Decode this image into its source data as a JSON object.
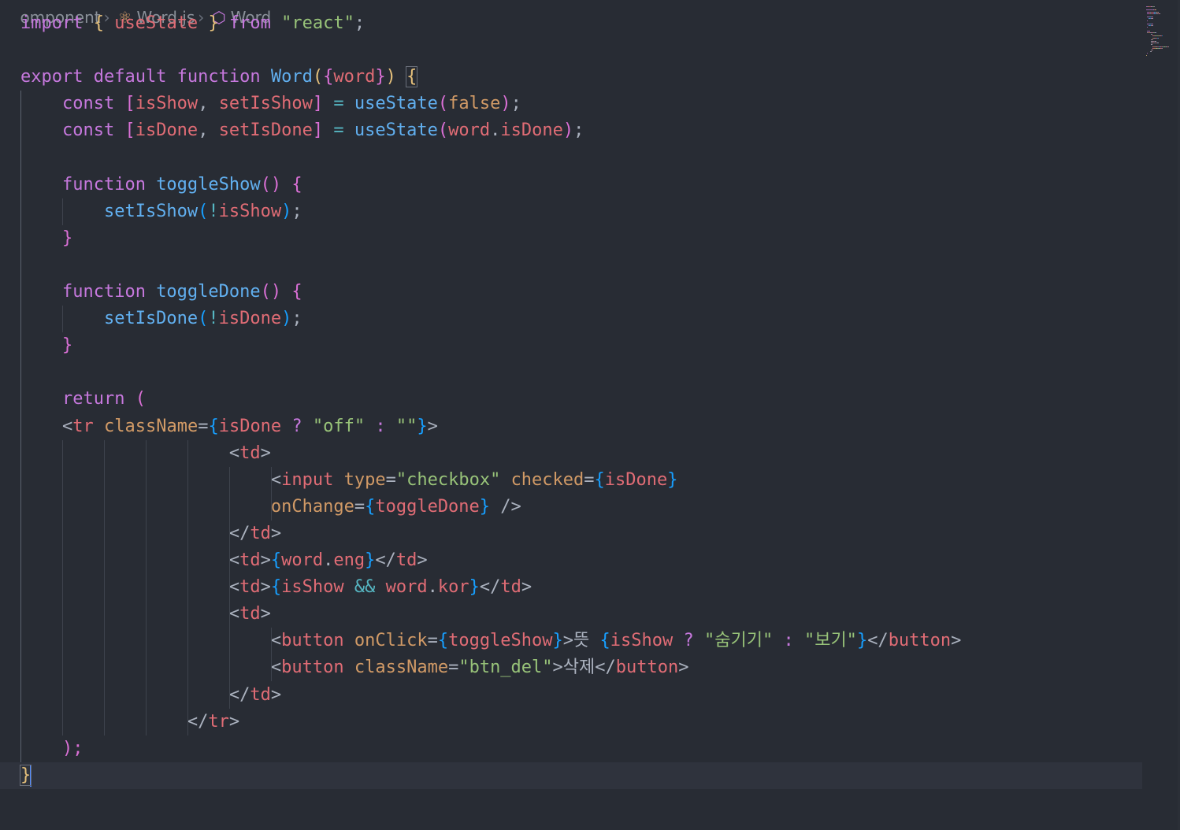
{
  "breadcrumb": {
    "folder": "omponent",
    "file": "Word.js",
    "symbol": "Word",
    "file_icon": "react-js-icon",
    "symbol_icon": "function-cube-icon"
  },
  "colors": {
    "background": "#282c34",
    "keyword": "#c678dd",
    "function": "#61afef",
    "string": "#98c379",
    "variable": "#e06c75",
    "attribute": "#d19a66",
    "plain": "#abb2bf",
    "bracket_gold": "#e5c07b",
    "bracket_purple": "#da70d6",
    "bracket_blue": "#179fff"
  },
  "lines": [
    [
      {
        "t": "import ",
        "c": "#c678dd"
      },
      {
        "t": "{ ",
        "c": "#e5c07b"
      },
      {
        "t": "useState ",
        "c": "#e06c75"
      },
      {
        "t": "} ",
        "c": "#e5c07b"
      },
      {
        "t": "from ",
        "c": "#c678dd"
      },
      {
        "t": "\"react\"",
        "c": "#98c379"
      },
      {
        "t": ";",
        "c": "#abb2bf"
      }
    ],
    [],
    [
      {
        "t": "export default function ",
        "c": "#c678dd"
      },
      {
        "t": "Word",
        "c": "#61afef"
      },
      {
        "t": "(",
        "c": "#e5c07b"
      },
      {
        "t": "{",
        "c": "#da70d6"
      },
      {
        "t": "word",
        "c": "#e06c75"
      },
      {
        "t": "}",
        "c": "#da70d6"
      },
      {
        "t": ")",
        "c": "#e5c07b"
      },
      {
        "t": " ",
        "c": "#abb2bf"
      },
      {
        "t": "{",
        "c": "#e5c07b",
        "m": 1
      }
    ],
    [
      {
        "t": "    const ",
        "c": "#c678dd"
      },
      {
        "t": "[",
        "c": "#da70d6"
      },
      {
        "t": "isShow",
        "c": "#e06c75"
      },
      {
        "t": ", ",
        "c": "#abb2bf"
      },
      {
        "t": "setIsShow",
        "c": "#e06c75"
      },
      {
        "t": "]",
        "c": "#da70d6"
      },
      {
        "t": " = ",
        "c": "#56b6c2"
      },
      {
        "t": "useState",
        "c": "#61afef"
      },
      {
        "t": "(",
        "c": "#da70d6"
      },
      {
        "t": "false",
        "c": "#d19a66"
      },
      {
        "t": ")",
        "c": "#da70d6"
      },
      {
        "t": ";",
        "c": "#abb2bf"
      }
    ],
    [
      {
        "t": "    const ",
        "c": "#c678dd"
      },
      {
        "t": "[",
        "c": "#da70d6"
      },
      {
        "t": "isDone",
        "c": "#e06c75"
      },
      {
        "t": ", ",
        "c": "#abb2bf"
      },
      {
        "t": "setIsDone",
        "c": "#e06c75"
      },
      {
        "t": "]",
        "c": "#da70d6"
      },
      {
        "t": " = ",
        "c": "#56b6c2"
      },
      {
        "t": "useState",
        "c": "#61afef"
      },
      {
        "t": "(",
        "c": "#da70d6"
      },
      {
        "t": "word",
        "c": "#e06c75"
      },
      {
        "t": ".",
        "c": "#abb2bf"
      },
      {
        "t": "isDone",
        "c": "#e06c75"
      },
      {
        "t": ")",
        "c": "#da70d6"
      },
      {
        "t": ";",
        "c": "#abb2bf"
      }
    ],
    [],
    [
      {
        "t": "    function ",
        "c": "#c678dd"
      },
      {
        "t": "toggleShow",
        "c": "#61afef"
      },
      {
        "t": "() {",
        "c": "#da70d6"
      }
    ],
    [
      {
        "t": "        setIsShow",
        "c": "#61afef"
      },
      {
        "t": "(",
        "c": "#179fff"
      },
      {
        "t": "!",
        "c": "#56b6c2"
      },
      {
        "t": "isShow",
        "c": "#e06c75"
      },
      {
        "t": ")",
        "c": "#179fff"
      },
      {
        "t": ";",
        "c": "#abb2bf"
      }
    ],
    [
      {
        "t": "    }",
        "c": "#da70d6"
      }
    ],
    [],
    [
      {
        "t": "    function ",
        "c": "#c678dd"
      },
      {
        "t": "toggleDone",
        "c": "#61afef"
      },
      {
        "t": "() {",
        "c": "#da70d6"
      }
    ],
    [
      {
        "t": "        setIsDone",
        "c": "#61afef"
      },
      {
        "t": "(",
        "c": "#179fff"
      },
      {
        "t": "!",
        "c": "#56b6c2"
      },
      {
        "t": "isDone",
        "c": "#e06c75"
      },
      {
        "t": ")",
        "c": "#179fff"
      },
      {
        "t": ";",
        "c": "#abb2bf"
      }
    ],
    [
      {
        "t": "    }",
        "c": "#da70d6"
      }
    ],
    [],
    [
      {
        "t": "    return ",
        "c": "#c678dd"
      },
      {
        "t": "(",
        "c": "#da70d6"
      }
    ],
    [
      {
        "t": "    <",
        "c": "#abb2bf"
      },
      {
        "t": "tr ",
        "c": "#e06c75"
      },
      {
        "t": "className",
        "c": "#d19a66"
      },
      {
        "t": "=",
        "c": "#abb2bf"
      },
      {
        "t": "{",
        "c": "#179fff"
      },
      {
        "t": "isDone ",
        "c": "#e06c75"
      },
      {
        "t": "? ",
        "c": "#c678dd"
      },
      {
        "t": "\"off\" ",
        "c": "#98c379"
      },
      {
        "t": ": ",
        "c": "#c678dd"
      },
      {
        "t": "\"\"",
        "c": "#98c379"
      },
      {
        "t": "}",
        "c": "#179fff"
      },
      {
        "t": ">",
        "c": "#abb2bf"
      }
    ],
    [
      {
        "t": "                    <",
        "c": "#abb2bf"
      },
      {
        "t": "td",
        "c": "#e06c75"
      },
      {
        "t": ">",
        "c": "#abb2bf"
      }
    ],
    [
      {
        "t": "                        <",
        "c": "#abb2bf"
      },
      {
        "t": "input ",
        "c": "#e06c75"
      },
      {
        "t": "type",
        "c": "#d19a66"
      },
      {
        "t": "=",
        "c": "#abb2bf"
      },
      {
        "t": "\"checkbox\" ",
        "c": "#98c379"
      },
      {
        "t": "checked",
        "c": "#d19a66"
      },
      {
        "t": "=",
        "c": "#abb2bf"
      },
      {
        "t": "{",
        "c": "#179fff"
      },
      {
        "t": "isDone",
        "c": "#e06c75"
      },
      {
        "t": "}",
        "c": "#179fff"
      }
    ],
    [
      {
        "t": "                        onChange",
        "c": "#d19a66"
      },
      {
        "t": "=",
        "c": "#abb2bf"
      },
      {
        "t": "{",
        "c": "#179fff"
      },
      {
        "t": "toggleDone",
        "c": "#e06c75"
      },
      {
        "t": "}",
        "c": "#179fff"
      },
      {
        "t": " />",
        "c": "#abb2bf"
      }
    ],
    [
      {
        "t": "                    </",
        "c": "#abb2bf"
      },
      {
        "t": "td",
        "c": "#e06c75"
      },
      {
        "t": ">",
        "c": "#abb2bf"
      }
    ],
    [
      {
        "t": "                    <",
        "c": "#abb2bf"
      },
      {
        "t": "td",
        "c": "#e06c75"
      },
      {
        "t": ">",
        "c": "#abb2bf"
      },
      {
        "t": "{",
        "c": "#179fff"
      },
      {
        "t": "word",
        "c": "#e06c75"
      },
      {
        "t": ".",
        "c": "#abb2bf"
      },
      {
        "t": "eng",
        "c": "#e06c75"
      },
      {
        "t": "}",
        "c": "#179fff"
      },
      {
        "t": "</",
        "c": "#abb2bf"
      },
      {
        "t": "td",
        "c": "#e06c75"
      },
      {
        "t": ">",
        "c": "#abb2bf"
      }
    ],
    [
      {
        "t": "                    <",
        "c": "#abb2bf"
      },
      {
        "t": "td",
        "c": "#e06c75"
      },
      {
        "t": ">",
        "c": "#abb2bf"
      },
      {
        "t": "{",
        "c": "#179fff"
      },
      {
        "t": "isShow ",
        "c": "#e06c75"
      },
      {
        "t": "&& ",
        "c": "#56b6c2"
      },
      {
        "t": "word",
        "c": "#e06c75"
      },
      {
        "t": ".",
        "c": "#abb2bf"
      },
      {
        "t": "kor",
        "c": "#e06c75"
      },
      {
        "t": "}",
        "c": "#179fff"
      },
      {
        "t": "</",
        "c": "#abb2bf"
      },
      {
        "t": "td",
        "c": "#e06c75"
      },
      {
        "t": ">",
        "c": "#abb2bf"
      }
    ],
    [
      {
        "t": "                    <",
        "c": "#abb2bf"
      },
      {
        "t": "td",
        "c": "#e06c75"
      },
      {
        "t": ">",
        "c": "#abb2bf"
      }
    ],
    [
      {
        "t": "                        <",
        "c": "#abb2bf"
      },
      {
        "t": "button ",
        "c": "#e06c75"
      },
      {
        "t": "onClick",
        "c": "#d19a66"
      },
      {
        "t": "=",
        "c": "#abb2bf"
      },
      {
        "t": "{",
        "c": "#179fff"
      },
      {
        "t": "toggleShow",
        "c": "#e06c75"
      },
      {
        "t": "}",
        "c": "#179fff"
      },
      {
        "t": ">뜻 ",
        "c": "#abb2bf"
      },
      {
        "t": "{",
        "c": "#179fff"
      },
      {
        "t": "isShow ",
        "c": "#e06c75"
      },
      {
        "t": "? ",
        "c": "#c678dd"
      },
      {
        "t": "\"숨기기\" ",
        "c": "#98c379"
      },
      {
        "t": ": ",
        "c": "#c678dd"
      },
      {
        "t": "\"보기\"",
        "c": "#98c379"
      },
      {
        "t": "}",
        "c": "#179fff"
      },
      {
        "t": "</",
        "c": "#abb2bf"
      },
      {
        "t": "button",
        "c": "#e06c75"
      },
      {
        "t": ">",
        "c": "#abb2bf"
      }
    ],
    [
      {
        "t": "                        <",
        "c": "#abb2bf"
      },
      {
        "t": "button ",
        "c": "#e06c75"
      },
      {
        "t": "className",
        "c": "#d19a66"
      },
      {
        "t": "=",
        "c": "#abb2bf"
      },
      {
        "t": "\"btn_del\"",
        "c": "#98c379"
      },
      {
        "t": ">삭제</",
        "c": "#abb2bf"
      },
      {
        "t": "button",
        "c": "#e06c75"
      },
      {
        "t": ">",
        "c": "#abb2bf"
      }
    ],
    [
      {
        "t": "                    </",
        "c": "#abb2bf"
      },
      {
        "t": "td",
        "c": "#e06c75"
      },
      {
        "t": ">",
        "c": "#abb2bf"
      }
    ],
    [
      {
        "t": "                </",
        "c": "#abb2bf"
      },
      {
        "t": "tr",
        "c": "#e06c75"
      },
      {
        "t": ">",
        "c": "#abb2bf"
      }
    ],
    [
      {
        "t": "    );",
        "c": "#da70d6"
      }
    ],
    [
      {
        "t": "}",
        "c": "#e5c07b",
        "m": 1,
        "cursor": 1
      }
    ]
  ]
}
